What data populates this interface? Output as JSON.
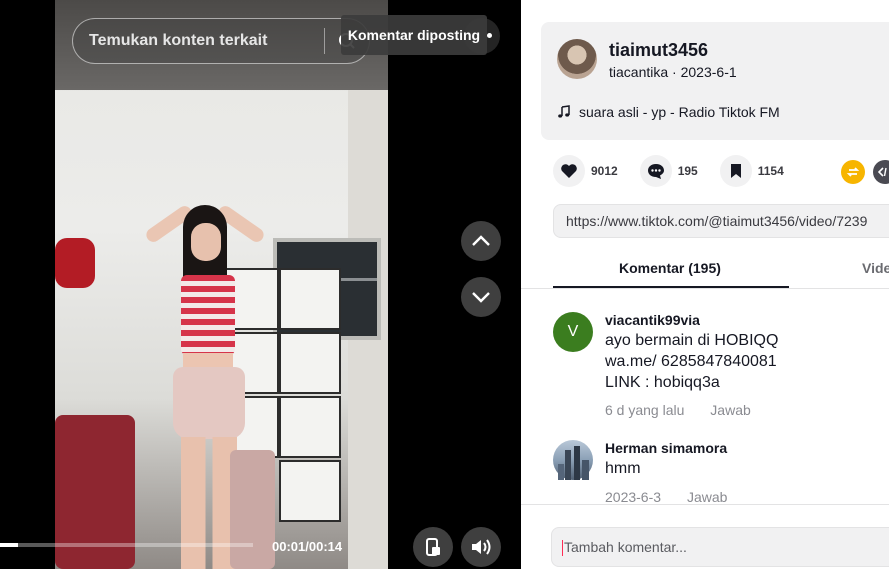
{
  "search": {
    "placeholder": "Temukan konten terkait"
  },
  "toast": {
    "text": "Komentar diposting"
  },
  "player": {
    "time": "00:01/00:14",
    "progress": 0.07
  },
  "author": {
    "username": "tiaimut3456",
    "nickname": "tiacantika",
    "date": "2023-6-1",
    "music": "suara asli - yp - Radio Tiktok FM"
  },
  "stats": {
    "likes": "9012",
    "comments": "195",
    "saves": "1154"
  },
  "share_colors": {
    "repost": "#f7b500",
    "embed": "#4a4a52"
  },
  "url": "https://www.tiktok.com/@tiaimut3456/video/7239",
  "tabs": {
    "comments": "Komentar (195)",
    "videos": "Vide"
  },
  "comments": [
    {
      "avatar_letter": "V",
      "avatar_color": "#3b7d1f",
      "name": "viacantik99via",
      "lines": [
        "ayo bermain di HOBIQQ",
        "wa.me/ 6285847840081",
        "LINK : hobiqq3a"
      ],
      "time": "6 d yang lalu",
      "reply": "Jawab"
    },
    {
      "avatar_letter": "",
      "avatar_color": "#7a8fa6",
      "name": "Herman simamora",
      "lines": [
        "hmm"
      ],
      "time": "2023-6-3",
      "reply": "Jawab"
    }
  ],
  "add_comment": {
    "placeholder": "Tambah komentar..."
  }
}
